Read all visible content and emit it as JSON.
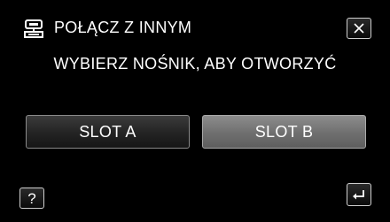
{
  "header": {
    "icon": "usb-connect-icon",
    "title": "POŁĄCZ Z INNYM"
  },
  "prompt": "WYBIERZ NOŚNIK, ABY OTWORZYĆ",
  "slots": {
    "slot_a_label": "SLOT A",
    "slot_b_label": "SLOT B"
  },
  "footer": {
    "help_label": "?",
    "help_icon": "question-icon",
    "back_icon": "return-icon"
  },
  "close_icon": "close-icon",
  "colors": {
    "background": "#000000",
    "button_dark": "#232323",
    "button_selected": "#6f6f6f",
    "text": "#ffffff"
  }
}
